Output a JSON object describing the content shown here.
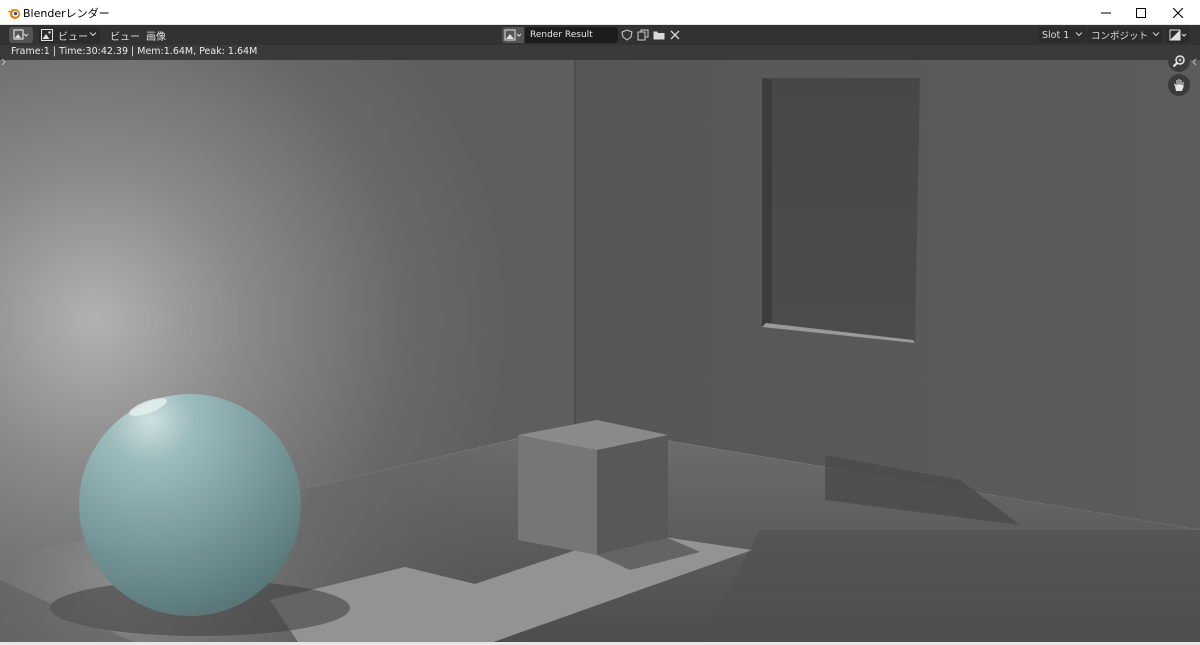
{
  "window": {
    "title": "Blenderレンダー",
    "controls": [
      "minimize",
      "maximize",
      "close"
    ]
  },
  "header": {
    "editor_type_icon": "image-editor-icon",
    "view_mode": "ビュー",
    "menus": [
      "ビュー",
      "画像"
    ],
    "image_name": "Render Result",
    "image_icons": [
      "fake-user-shield-icon",
      "duplicate-icon",
      "folder-icon",
      "unlink-x-icon"
    ],
    "slot": "Slot 1",
    "layer": "コンポジット",
    "display_icon": "display-channels-icon"
  },
  "stats": {
    "text": "Frame:1 | Time:30:42.39 | Mem:1.64M, Peak: 1.64M"
  },
  "viewport": {
    "content": "render-result-image",
    "gizmos": [
      "zoom-icon",
      "pan-hand-icon"
    ]
  },
  "colors": {
    "header_bg": "#323232",
    "stats_bg": "#3a3a3a",
    "field_bg": "#1d1d1d",
    "sphere": "#7fa1a3",
    "wall": "#5a5a5a"
  }
}
